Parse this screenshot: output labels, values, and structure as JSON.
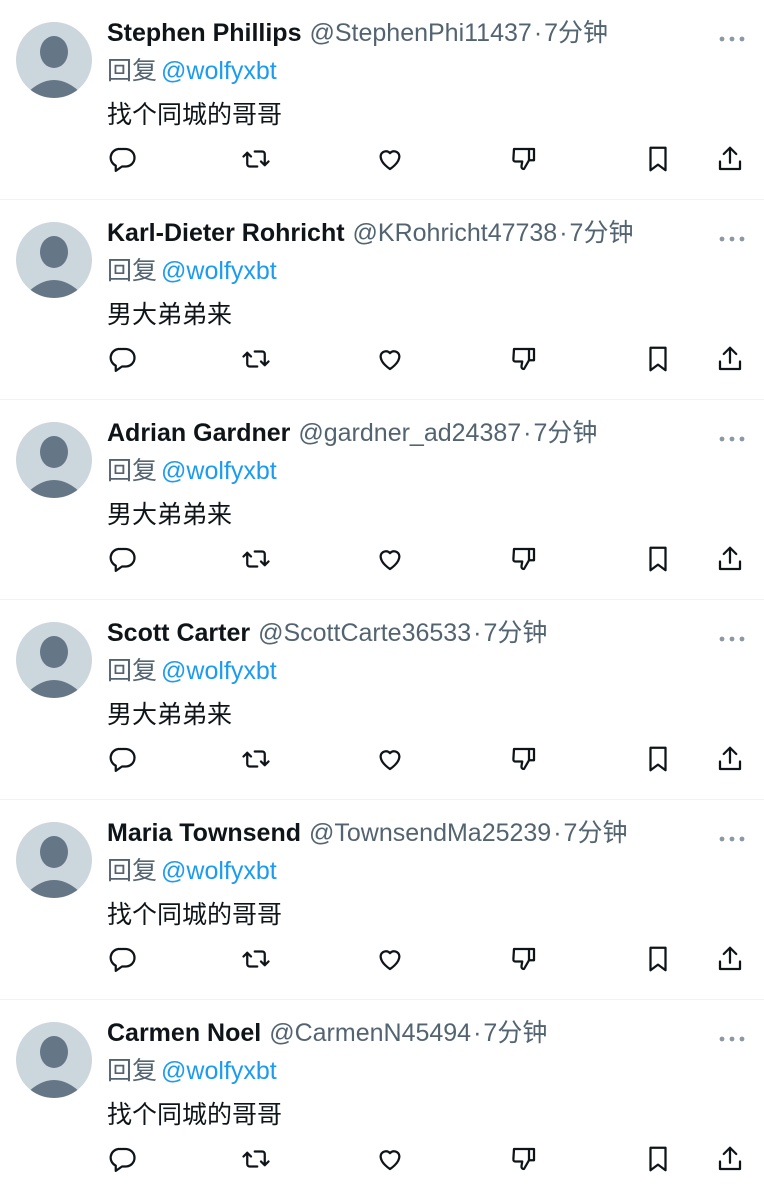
{
  "tweets": [
    {
      "name": "Stephen Phillips",
      "handle": "@StephenPhi11437",
      "dot": "·",
      "time": "7分钟",
      "reply_prefix": "回复",
      "reply_to": "@wolfyxbt",
      "text": "找个同城的哥哥"
    },
    {
      "name": "Karl-Dieter Rohricht",
      "handle": "@KRohricht47738",
      "dot": "·",
      "time": "7分钟",
      "reply_prefix": "回复",
      "reply_to": "@wolfyxbt",
      "text": "男大弟弟来"
    },
    {
      "name": "Adrian Gardner",
      "handle": "@gardner_ad24387",
      "dot": "·",
      "time": "7分钟",
      "reply_prefix": "回复",
      "reply_to": "@wolfyxbt",
      "text": "男大弟弟来"
    },
    {
      "name": "Scott Carter",
      "handle": "@ScottCarte36533",
      "dot": "·",
      "time": "7分钟",
      "reply_prefix": "回复",
      "reply_to": "@wolfyxbt",
      "text": "男大弟弟来"
    },
    {
      "name": "Maria Townsend",
      "handle": "@TownsendMa25239",
      "dot": "·",
      "time": "7分钟",
      "reply_prefix": "回复",
      "reply_to": "@wolfyxbt",
      "text": "找个同城的哥哥"
    },
    {
      "name": "Carmen Noel",
      "handle": "@CarmenN45494",
      "dot": "·",
      "time": "7分钟",
      "reply_prefix": "回复",
      "reply_to": "@wolfyxbt",
      "text": "找个同城的哥哥"
    }
  ],
  "icons": {
    "avatar": "default-avatar-icon",
    "more": "more-options-icon",
    "reply": "reply-icon",
    "retweet": "retweet-icon",
    "like": "heart-icon",
    "dislike": "dislike-icon",
    "bookmark": "bookmark-icon",
    "share": "share-icon"
  },
  "colors": {
    "text": "#0f1419",
    "secondary": "#536471",
    "link": "#1d9bf0",
    "avatar_bg": "#ccd6dd",
    "avatar_fg": "#657786",
    "divider": "#eff3f4"
  }
}
